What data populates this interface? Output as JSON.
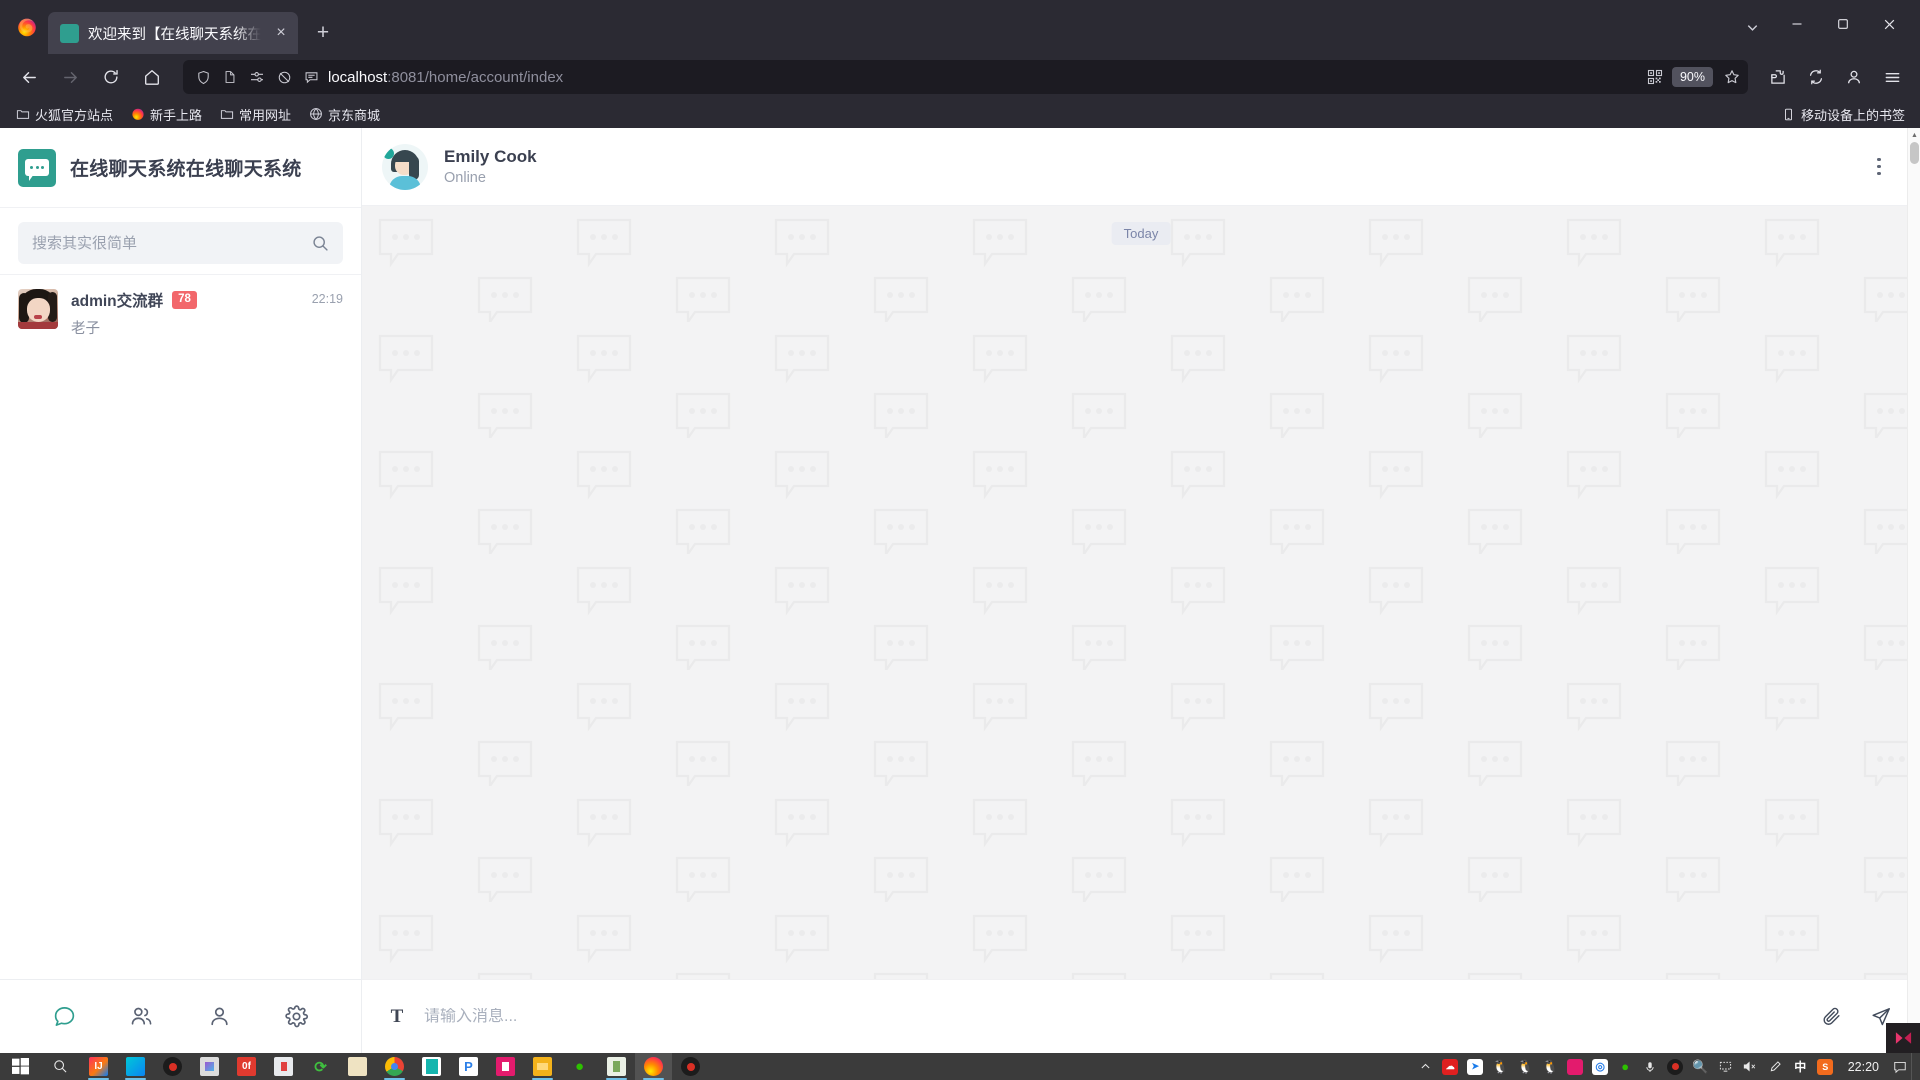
{
  "browser": {
    "tab": {
      "title": "欢迎来到【在线聊天系统在线聊",
      "favicon": "chat-bubble-icon",
      "close": "×"
    },
    "newtab_label": "+",
    "url": {
      "host": "localhost",
      "path": ":8081/home/account/index",
      "full": "localhost:8081/home/account/index"
    },
    "zoom_level": "90%",
    "icons": {
      "back": "back-arrow-icon",
      "forward": "forward-arrow-icon",
      "reload": "reload-icon",
      "home": "home-icon",
      "shield": "shield-icon",
      "page": "page-icon",
      "permissions": "permissions-icon",
      "tracking_off": "tracking-protection-off-icon",
      "reader": "reader-view-icon",
      "qr": "qr-code-icon",
      "star": "bookmark-star-icon",
      "extensions": "extensions-icon",
      "sync": "sync-icon",
      "account": "account-icon",
      "menu": "hamburger-menu-icon",
      "list_all_tabs": "chevron-down-icon",
      "minimize": "minimize-icon",
      "maximize": "maximize-icon",
      "close": "window-close-icon"
    },
    "bookmarks": [
      {
        "label": "火狐官方站点",
        "icon": "folder-icon"
      },
      {
        "label": "新手上路",
        "icon": "firefox-icon"
      },
      {
        "label": "常用网址",
        "icon": "folder-icon"
      },
      {
        "label": "京东商城",
        "icon": "globe-icon"
      }
    ],
    "bookmarks_right": {
      "label": "移动设备上的书签",
      "icon": "mobile-device-icon"
    }
  },
  "app": {
    "brand": {
      "title": "在线聊天系统在线聊天系统",
      "logo": "chat-bubble-logo"
    },
    "search": {
      "value": "",
      "placeholder": "搜索其实很简单",
      "icon": "search-icon"
    },
    "chats": [
      {
        "name": "admin交流群",
        "badge": "78",
        "preview": "老子",
        "time": "22:19",
        "avatar": "group-avatar"
      }
    ],
    "nav_tabs": [
      {
        "name": "chats",
        "icon": "chat-icon",
        "active": true
      },
      {
        "name": "contacts",
        "icon": "users-icon",
        "active": false
      },
      {
        "name": "profile",
        "icon": "person-icon",
        "active": false
      },
      {
        "name": "settings",
        "icon": "gear-icon",
        "active": false
      }
    ],
    "conversation": {
      "name": "Emily Cook",
      "status": "Online",
      "date_divider": "Today",
      "more_icon": "more-vertical-icon",
      "messages": []
    },
    "composer": {
      "format_label": "T",
      "value": "",
      "placeholder": "请输入消息...",
      "attach_icon": "paperclip-icon",
      "send_icon": "send-plane-icon"
    },
    "colors": {
      "accent": "#2f9e8f",
      "badge": "#f2676b",
      "chat_bg": "#f3f3f4",
      "title": "#3b4050"
    }
  },
  "taskbar": {
    "start": "windows-start-icon",
    "search": "search-icon",
    "time": "22:20",
    "apps": [
      "intellij-icon",
      "firefox-dev-icon",
      "record-red-icon",
      "photos-icon",
      "office-red-icon",
      "paint-icon",
      "sync-green-icon",
      "snip-icon",
      "chrome-icon",
      "teal-app-icon",
      "p-blue-icon",
      "magenta-app-icon",
      "explorer-icon",
      "wechat-icon",
      "notepad-icon",
      "firefox-icon",
      "record-icon"
    ],
    "tray": [
      "chevron-up-icon",
      "cloud-red-icon",
      "blue-arrow-icon",
      "qq-icon",
      "qq-icon",
      "qq-icon",
      "magenta-icon",
      "app-blue-icon",
      "wechat-icon",
      "microphone-icon",
      "record-icon",
      "search-orange-icon",
      "display-icon",
      "mute-icon",
      "pen-icon",
      "ime-chinese-icon",
      "sogou-icon"
    ],
    "notification": "notification-icon"
  }
}
